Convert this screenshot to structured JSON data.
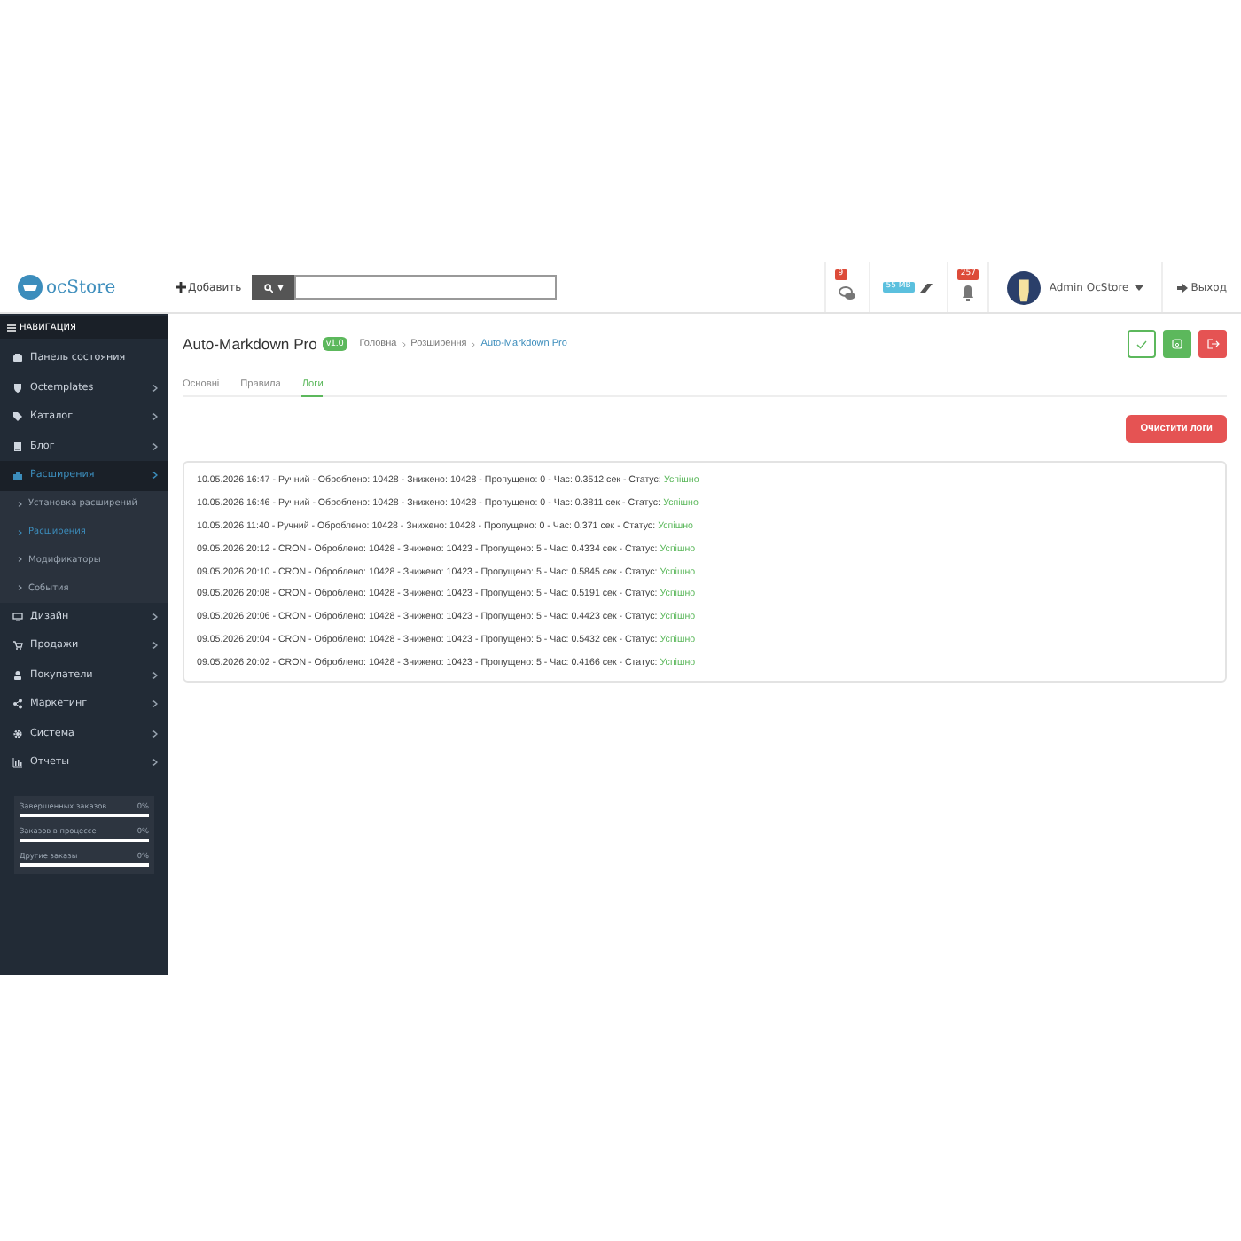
{
  "header": {
    "logo": "ocStore",
    "add_button": "Добавить",
    "search_button": "▾",
    "badges": [
      {
        "kind": "messages",
        "text": "9"
      },
      {
        "kind": "storage",
        "text": "55 MB"
      },
      {
        "kind": "alerts",
        "text": "257"
      }
    ],
    "user": "Admin OcStore",
    "logout": "Выход"
  },
  "sidebar": {
    "title": "НАВИГАЦИЯ",
    "items": [
      {
        "label": "Панель состояния",
        "expanded": false,
        "has_children": false
      },
      {
        "label": "Octemplates",
        "expanded": false,
        "has_children": true
      },
      {
        "label": "Каталог",
        "expanded": false,
        "has_children": true
      },
      {
        "label": "Блог",
        "expanded": false,
        "has_children": true
      },
      {
        "label": "Расширения",
        "expanded": true,
        "has_children": true,
        "children": [
          {
            "label": "Установка расширений",
            "selected": false
          },
          {
            "label": "Расширения",
            "selected": true
          },
          {
            "label": "Модификаторы",
            "selected": false
          },
          {
            "label": "События",
            "selected": false
          }
        ]
      },
      {
        "label": "Дизайн",
        "expanded": false,
        "has_children": true
      },
      {
        "label": "Продажи",
        "expanded": false,
        "has_children": true
      },
      {
        "label": "Покупатели",
        "expanded": false,
        "has_children": true
      },
      {
        "label": "Маркетинг",
        "expanded": false,
        "has_children": true
      },
      {
        "label": "Система",
        "expanded": false,
        "has_children": true
      },
      {
        "label": "Отчеты",
        "expanded": false,
        "has_children": true
      }
    ],
    "stats": [
      {
        "label": "Завершенных заказов",
        "value": "0%",
        "level": 0
      },
      {
        "label": "Заказов в процессе",
        "value": "0%",
        "level": 0
      },
      {
        "label": "Другие заказы",
        "value": "0%",
        "level": 0
      }
    ]
  },
  "page": {
    "title": "Auto-Markdown Pro",
    "version": "v1.0",
    "breadcrumbs": [
      {
        "label": "Головна",
        "current": false
      },
      {
        "label": "Розширення",
        "current": false
      },
      {
        "label": "Auto-Markdown Pro",
        "current": true
      }
    ],
    "actions": [
      {
        "kind": "check"
      },
      {
        "kind": "save"
      },
      {
        "kind": "exit"
      }
    ],
    "tabs": [
      {
        "label": "Основні",
        "selected": false
      },
      {
        "label": "Правила",
        "selected": false
      },
      {
        "label": "Логи",
        "selected": true
      }
    ],
    "clear_button": "Очистити логи",
    "logs": [
      {
        "text": "10.05.2026 16:47 - Ручний - Оброблено: 10428 - Знижено: 10428 - Пропущено: 0 - Час: 0.3512 сек - Статус:",
        "status": "Успішно"
      },
      {
        "text": "10.05.2026 16:46 - Ручний - Оброблено: 10428 - Знижено: 10428 - Пропущено: 0 - Час: 0.3811 сек - Статус:",
        "status": "Успішно"
      },
      {
        "text": "10.05.2026 11:40 - Ручний - Оброблено: 10428 - Знижено: 10428 - Пропущено: 0 - Час: 0.371 сек - Статус:",
        "status": "Успішно"
      },
      {
        "text": "09.05.2026 20:12 - CRON - Оброблено: 10428 - Знижено: 10423 - Пропущено: 5 - Час: 0.4334 сек - Статус:",
        "status": "Успішно"
      },
      {
        "text": "09.05.2026 20:10 - CRON - Оброблено: 10428 - Знижено: 10423 - Пропущено: 5 - Час: 0.5845 сек - Статус:",
        "status": "Успішно"
      },
      {
        "text": "09.05.2026 20:08 - CRON - Оброблено: 10428 - Знижено: 10423 - Пропущено: 5 - Час: 0.5191 сек - Статус:",
        "status": "Успішно"
      },
      {
        "text": "09.05.2026 20:06 - CRON - Оброблено: 10428 - Знижено: 10423 - Пропущено: 5 - Час: 0.4423 сек - Статус:",
        "status": "Успішно"
      },
      {
        "text": "09.05.2026 20:04 - CRON - Оброблено: 10428 - Знижено: 10423 - Пропущено: 5 - Час: 0.5432 сек - Статус:",
        "status": "Успішно"
      },
      {
        "text": "09.05.2026 20:02 - CRON - Оброблено: 10428 - Знижено: 10423 - Пропущено: 5 - Час: 0.4166 сек - Статус:",
        "status": "Успішно"
      }
    ]
  }
}
